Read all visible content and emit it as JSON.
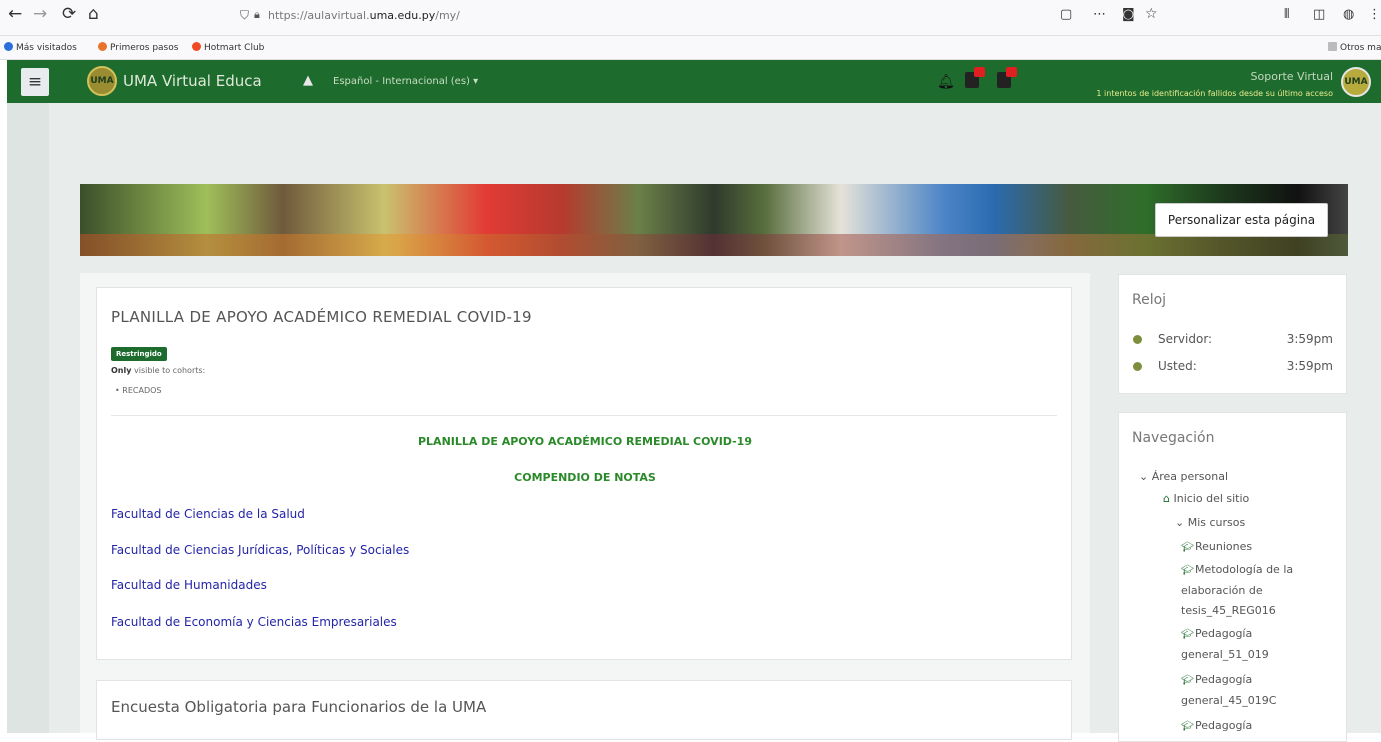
{
  "browser": {
    "url_prefix": "https://aulavirtual.",
    "url_domain": "uma.edu.py",
    "url_path": "/my/",
    "bookmarks": [
      {
        "label": "Más visitados",
        "color": "#2a6fdb"
      },
      {
        "label": "Primeros pasos",
        "color": "#e8732a"
      },
      {
        "label": "Hotmart Club",
        "color": "#f04a24"
      },
      {
        "label": "Otros ma",
        "color": "#999999"
      }
    ]
  },
  "navbar": {
    "site_name": "UMA Virtual Educa",
    "language": "Español - Internacional (es) ▾",
    "user_name": "Soporte Virtual",
    "login_warning": "1 intentos de identificación fallidos desde su último acceso",
    "logo_text": "UMA",
    "accent_color": "#1e6b2e"
  },
  "customize_button": "Personalizar esta página",
  "main_card": {
    "title": "PLANILLA DE APOYO ACADÉMICO REMEDIAL COVID-19",
    "badge": "Restringido",
    "only_visible_bold": "Only",
    "only_visible_rest": " visible to cohorts:",
    "recados": "RECADOS",
    "heading": "PLANILLA DE APOYO ACADÉMICO REMEDIAL COVID-19",
    "subheading": "COMPENDIO DE NOTAS",
    "links": [
      "Facultad de Ciencias de la Salud",
      "Facultad de Ciencias Jurídicas, Políticas y Sociales",
      "Facultad de Humanidades",
      "Facultad de Economía y Ciencias Empresariales"
    ]
  },
  "second_card": {
    "title": "Encuesta Obligatoria para Funcionarios de la UMA"
  },
  "clock_block": {
    "title": "Reloj",
    "rows": [
      {
        "label": "Servidor:",
        "value": "3:59pm"
      },
      {
        "label": "Usted:",
        "value": "3:59pm"
      }
    ]
  },
  "navigation_block": {
    "title": "Navegación",
    "area_personal": "Área personal",
    "inicio": "Inicio del sitio",
    "mis_cursos": "Mis cursos",
    "courses": [
      "Reuniones",
      "Metodología de la elaboración de tesis_45_REG016",
      "Pedagogía general_51_019",
      "Pedagogía general_45_019C",
      "Pedagogía"
    ]
  }
}
